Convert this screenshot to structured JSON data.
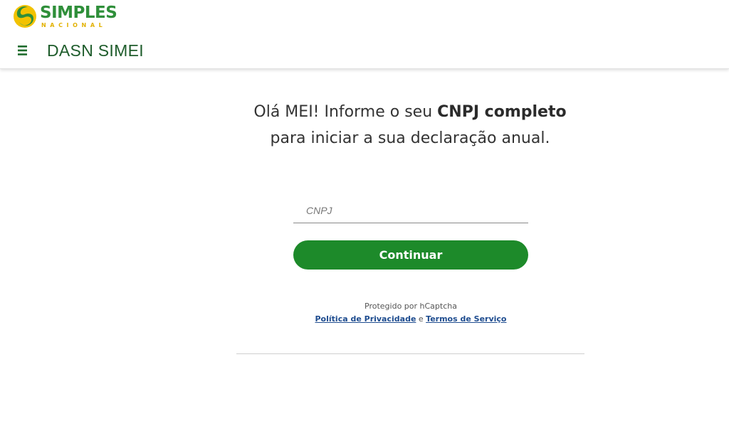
{
  "header": {
    "logo_main": "SIMPLES",
    "logo_sub": "NACIONAL",
    "menu_icon": "hamburger-menu-icon",
    "app_title": "DASN SIMEI"
  },
  "main": {
    "heading_line1_part1": "Olá MEI! Informe o seu ",
    "heading_line1_bold": "CNPJ completo",
    "heading_line2": "para iniciar a sua declaração anual.",
    "cnpj_placeholder": "CNPJ",
    "cnpj_value": "",
    "continue_label": "Continuar",
    "captcha_text": "Protegido por hCaptcha",
    "privacy_link": "Política de Privacidade",
    "conjunction": " e ",
    "terms_link": "Termos de Serviço"
  },
  "colors": {
    "brand_green": "#2f8f3a",
    "brand_yellow": "#e2b100",
    "button_green": "#1d8a2a",
    "title_green": "#1e5c2b",
    "link_blue": "#1e4c8f"
  }
}
